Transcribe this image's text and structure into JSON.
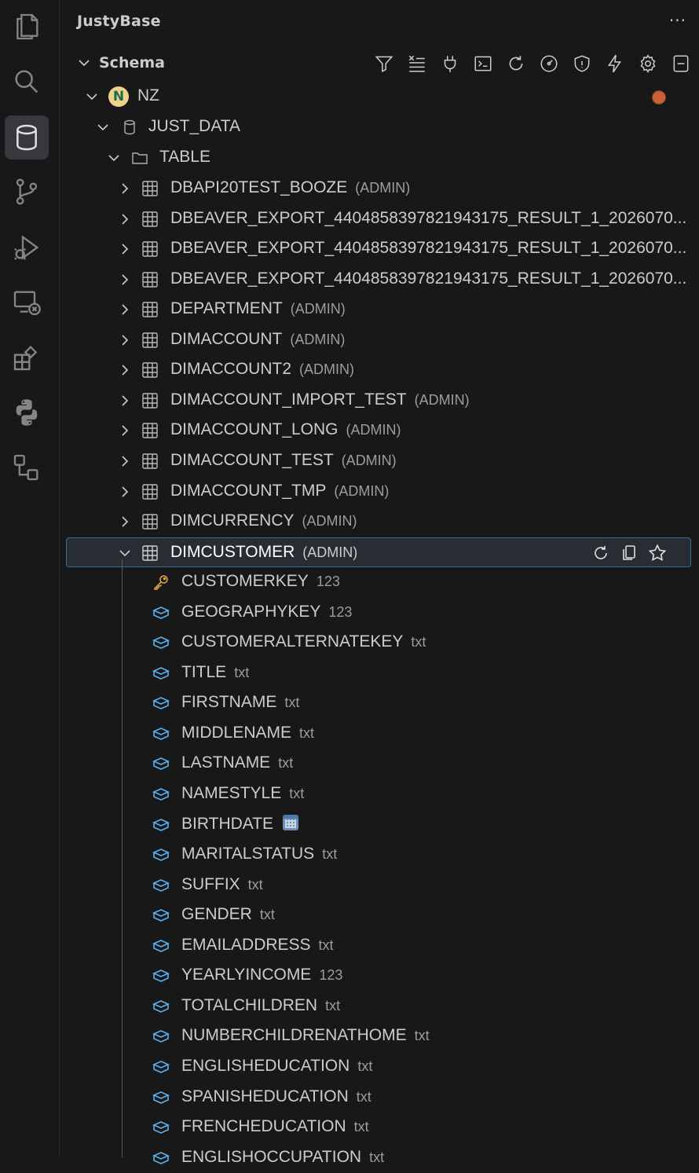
{
  "sidebar": {
    "title": "JustyBase",
    "more": "···",
    "section": "Schema"
  },
  "activity_bar": [
    "explorer-icon",
    "search-icon",
    "database-icon",
    "source-control-icon",
    "run-debug-icon",
    "remote-explorer-icon",
    "extensions-icon",
    "python-icon",
    "diagram-icon"
  ],
  "toolbar": [
    "filter-icon",
    "clear-filter-icon",
    "plug-icon",
    "terminal-icon",
    "refresh-icon",
    "dashboard-icon",
    "shield-icon",
    "lightning-icon",
    "gear-icon",
    "collapse-all-icon"
  ],
  "tree": {
    "connection": "NZ",
    "connection_status_color": "#c8603a",
    "database": "JUST_DATA",
    "folder": "TABLE",
    "tables": [
      {
        "name": "DBAPI20TEST_BOOZE",
        "owner": "(ADMIN)"
      },
      {
        "name": "DBEAVER_EXPORT_4404858397821943175_RESULT_1_2026070...",
        "owner": ""
      },
      {
        "name": "DBEAVER_EXPORT_4404858397821943175_RESULT_1_2026070...",
        "owner": ""
      },
      {
        "name": "DBEAVER_EXPORT_4404858397821943175_RESULT_1_2026070...",
        "owner": ""
      },
      {
        "name": "DEPARTMENT",
        "owner": "(ADMIN)"
      },
      {
        "name": "DIMACCOUNT",
        "owner": "(ADMIN)"
      },
      {
        "name": "DIMACCOUNT2",
        "owner": "(ADMIN)"
      },
      {
        "name": "DIMACCOUNT_IMPORT_TEST",
        "owner": "(ADMIN)"
      },
      {
        "name": "DIMACCOUNT_LONG",
        "owner": "(ADMIN)"
      },
      {
        "name": "DIMACCOUNT_TEST",
        "owner": "(ADMIN)"
      },
      {
        "name": "DIMACCOUNT_TMP",
        "owner": "(ADMIN)"
      },
      {
        "name": "DIMCURRENCY",
        "owner": "(ADMIN)"
      }
    ],
    "selected_table": {
      "name": "DIMCUSTOMER",
      "owner": "(ADMIN)"
    },
    "columns": [
      {
        "name": "CUSTOMERKEY",
        "type": "123",
        "key": true
      },
      {
        "name": "GEOGRAPHYKEY",
        "type": "123"
      },
      {
        "name": "CUSTOMERALTERNATEKEY",
        "type": "txt"
      },
      {
        "name": "TITLE",
        "type": "txt"
      },
      {
        "name": "FIRSTNAME",
        "type": "txt"
      },
      {
        "name": "MIDDLENAME",
        "type": "txt"
      },
      {
        "name": "LASTNAME",
        "type": "txt"
      },
      {
        "name": "NAMESTYLE",
        "type": "txt"
      },
      {
        "name": "BIRTHDATE",
        "type": "",
        "date": true
      },
      {
        "name": "MARITALSTATUS",
        "type": "txt"
      },
      {
        "name": "SUFFIX",
        "type": "txt"
      },
      {
        "name": "GENDER",
        "type": "txt"
      },
      {
        "name": "EMAILADDRESS",
        "type": "txt"
      },
      {
        "name": "YEARLYINCOME",
        "type": "123"
      },
      {
        "name": "TOTALCHILDREN",
        "type": "txt"
      },
      {
        "name": "NUMBERCHILDRENATHOME",
        "type": "txt"
      },
      {
        "name": "ENGLISHEDUCATION",
        "type": "txt"
      },
      {
        "name": "SPANISHEDUCATION",
        "type": "txt"
      },
      {
        "name": "FRENCHEDUCATION",
        "type": "txt"
      },
      {
        "name": "ENGLISHOCCUPATION",
        "type": "txt"
      }
    ]
  }
}
